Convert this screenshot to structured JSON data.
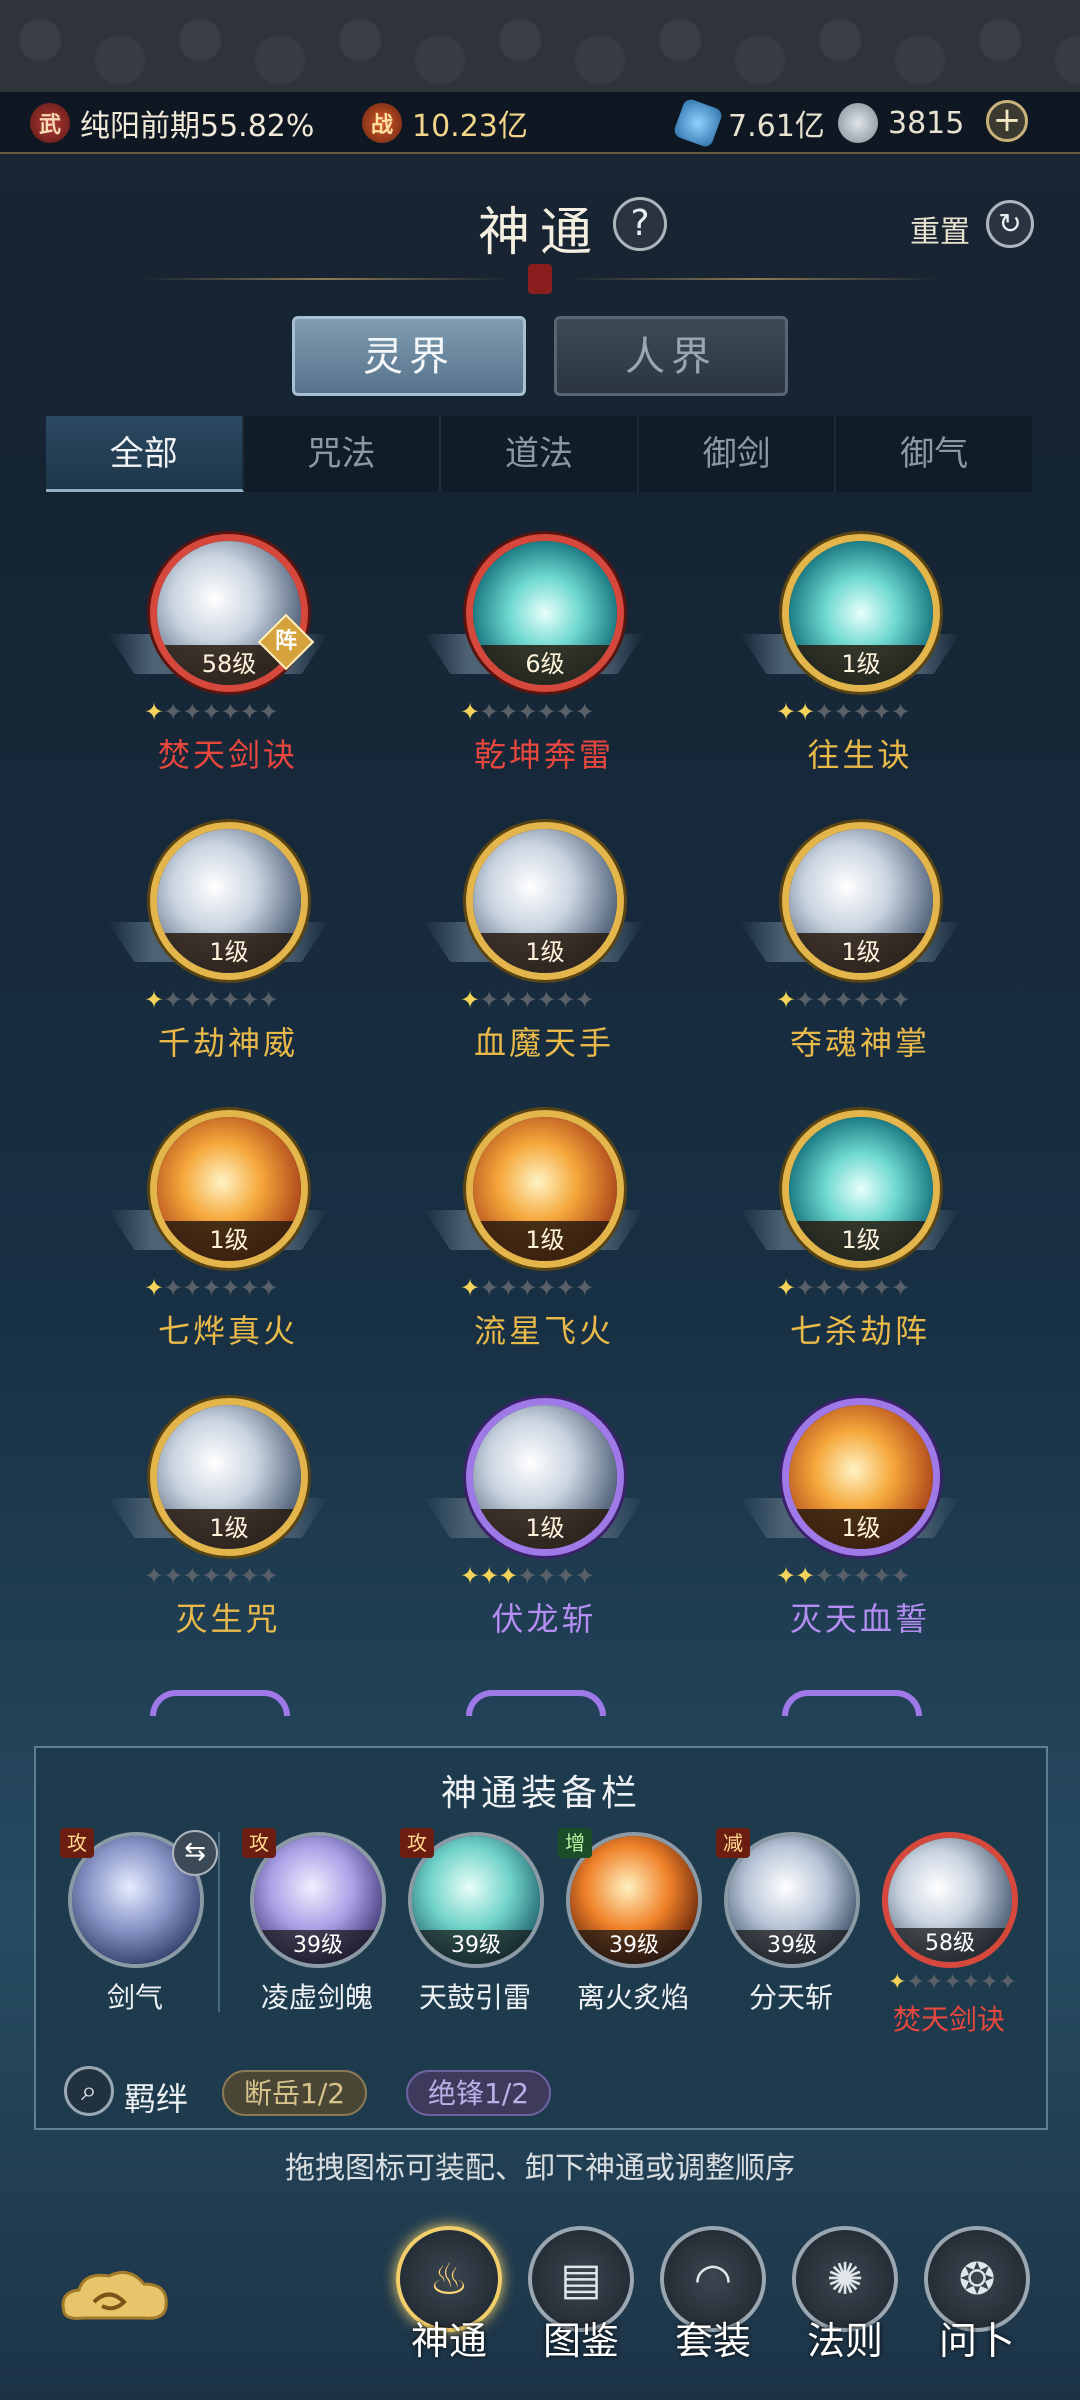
{
  "resources": {
    "realm_stage": "纯阳前期55.82%",
    "realm_icon": "武",
    "combat_power": "10.23亿",
    "combat_icon": "战",
    "spirit_stone": "7.61亿",
    "currency": "3815",
    "add_symbol": "+"
  },
  "header": {
    "title": "神通",
    "help_symbol": "?",
    "reset_label": "重置",
    "reset_symbol": "↻"
  },
  "realm_tabs": [
    "灵界",
    "人界"
  ],
  "category_tabs": [
    "全部",
    "咒法",
    "道法",
    "御剑",
    "御气"
  ],
  "skills": [
    {
      "name": "焚天剑诀",
      "level": "58级",
      "rarity": "red",
      "stars": 1,
      "badge": "阵",
      "art": "white"
    },
    {
      "name": "乾坤奔雷",
      "level": "6级",
      "rarity": "red",
      "stars": 1,
      "art": "teal"
    },
    {
      "name": "往生诀",
      "level": "1级",
      "rarity": "gold",
      "stars": 2,
      "art": "teal"
    },
    {
      "name": "千劫神威",
      "level": "1级",
      "rarity": "gold",
      "stars": 1,
      "art": "white"
    },
    {
      "name": "血魔天手",
      "level": "1级",
      "rarity": "gold",
      "stars": 1,
      "art": "white"
    },
    {
      "name": "夺魂神掌",
      "level": "1级",
      "rarity": "gold",
      "stars": 1,
      "art": "white"
    },
    {
      "name": "七烨真火",
      "level": "1级",
      "rarity": "gold",
      "stars": 1,
      "art": "fire"
    },
    {
      "name": "流星飞火",
      "level": "1级",
      "rarity": "gold",
      "stars": 1,
      "art": "fire"
    },
    {
      "name": "七杀劫阵",
      "level": "1级",
      "rarity": "gold",
      "stars": 1,
      "art": "teal"
    },
    {
      "name": "灭生咒",
      "level": "1级",
      "rarity": "gold",
      "stars": 0,
      "art": "white"
    },
    {
      "name": "伏龙斩",
      "level": "1级",
      "rarity": "purple",
      "stars": 3,
      "art": "white"
    },
    {
      "name": "灭天血誓",
      "level": "1级",
      "rarity": "purple",
      "stars": 2,
      "art": "fire"
    }
  ],
  "equip_panel": {
    "title": "神通装备栏",
    "slots": [
      {
        "name": "剑气",
        "tag": "攻",
        "level": "",
        "swap": "⇆"
      },
      {
        "name": "凌虚剑魄",
        "tag": "攻",
        "level": "39级"
      },
      {
        "name": "天鼓引雷",
        "tag": "攻",
        "level": "39级"
      },
      {
        "name": "离火炙焰",
        "tag": "增",
        "level": "39级"
      },
      {
        "name": "分天斩",
        "tag": "减",
        "level": "39级"
      },
      {
        "name": "焚天剑诀",
        "tag": "",
        "level": "58级",
        "stars": 1
      }
    ],
    "fetter_label": "羁绊",
    "fetters": [
      "断岳1/2",
      "绝锋1/2"
    ],
    "hint": "拖拽图标可装配、卸下神通或调整顺序"
  },
  "bottom_nav": [
    {
      "label": "神通",
      "icon": "flame-icon",
      "active": true
    },
    {
      "label": "图鉴",
      "icon": "book-icon",
      "active": false
    },
    {
      "label": "套装",
      "icon": "fan-icon",
      "active": false
    },
    {
      "label": "法则",
      "icon": "sigil-icon",
      "active": false
    },
    {
      "label": "问卜",
      "icon": "oracle-icon",
      "active": false
    }
  ],
  "colors": {
    "red": "#d5483b",
    "gold": "#e4b54a",
    "purple": "#9f79e8",
    "star_on": "#f3d35a"
  }
}
